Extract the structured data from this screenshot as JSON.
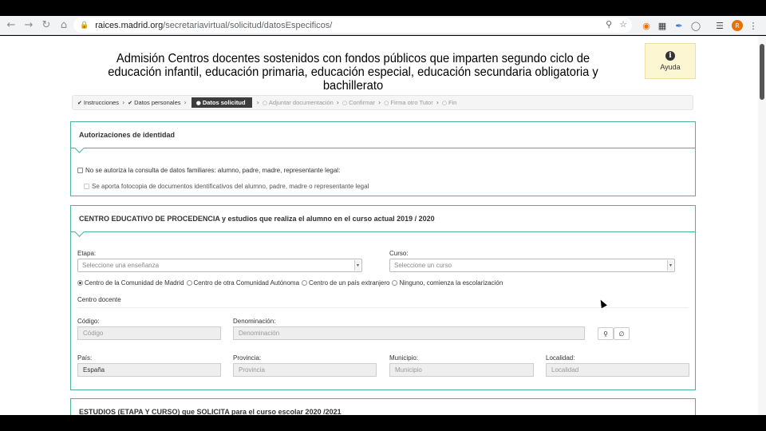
{
  "browser": {
    "url_host": "raices.madrid.org",
    "url_path": "/secretariavirtual/solicitud/datosEspecificos/",
    "profile_initial": "R"
  },
  "page": {
    "title": "Admisión Centros docentes sostenidos con fondos públicos que imparten segundo ciclo de educación infantil, educación primaria, educación especial, educación secundaria obligatoria y bachillerato",
    "help_label": "Ayuda",
    "help_glyph": "i"
  },
  "steps": [
    {
      "label": "Instrucciones",
      "state": "done"
    },
    {
      "label": "Datos personales",
      "state": "done"
    },
    {
      "label": "Datos solicitud",
      "state": "current"
    },
    {
      "label": "Adjuntar documentación",
      "state": "pending"
    },
    {
      "label": "Confirmar",
      "state": "pending"
    },
    {
      "label": "Firma otro Tutor",
      "state": "pending"
    },
    {
      "label": "Fin",
      "state": "pending"
    }
  ],
  "identity": {
    "title": "Autorizaciones de identidad",
    "check1": "No se autoriza la consulta de datos familiares: alumno, padre, madre, representante legal:",
    "check2": "Se aporta fotocopia de documentos identificativos del alumno, padre, madre o representante legal"
  },
  "origin": {
    "title": "CENTRO EDUCATIVO DE PROCEDENCIA y estudios que realiza el alumno en el curso actual 2019 / 2020",
    "etapa_label": "Etapa:",
    "etapa_value": "Seleccione una enseñanza",
    "curso_label": "Curso:",
    "curso_value": "Seleccione un curso",
    "radios": [
      {
        "label": "Centro de la Comunidad de Madrid",
        "selected": true
      },
      {
        "label": "Centro de otra Comunidad Autónoma",
        "selected": false
      },
      {
        "label": "Centro de un país extranjero",
        "selected": false
      },
      {
        "label": "Ninguno, comienza la escolarización",
        "selected": false
      }
    ],
    "centro_heading": "Centro docente",
    "codigo_label": "Código:",
    "codigo_placeholder": "Código",
    "denominacion_label": "Denominación:",
    "denominacion_placeholder": "Denominación",
    "pais_label": "País:",
    "pais_value": "España",
    "provincia_label": "Provincia:",
    "provincia_placeholder": "Provincia",
    "municipio_label": "Municipio:",
    "municipio_placeholder": "Municipio",
    "localidad_label": "Localidad:",
    "localidad_placeholder": "Localidad"
  },
  "requested": {
    "title": "ESTUDIOS (ETAPA Y CURSO) que SOLICITA para el curso escolar 2020 /2021"
  }
}
